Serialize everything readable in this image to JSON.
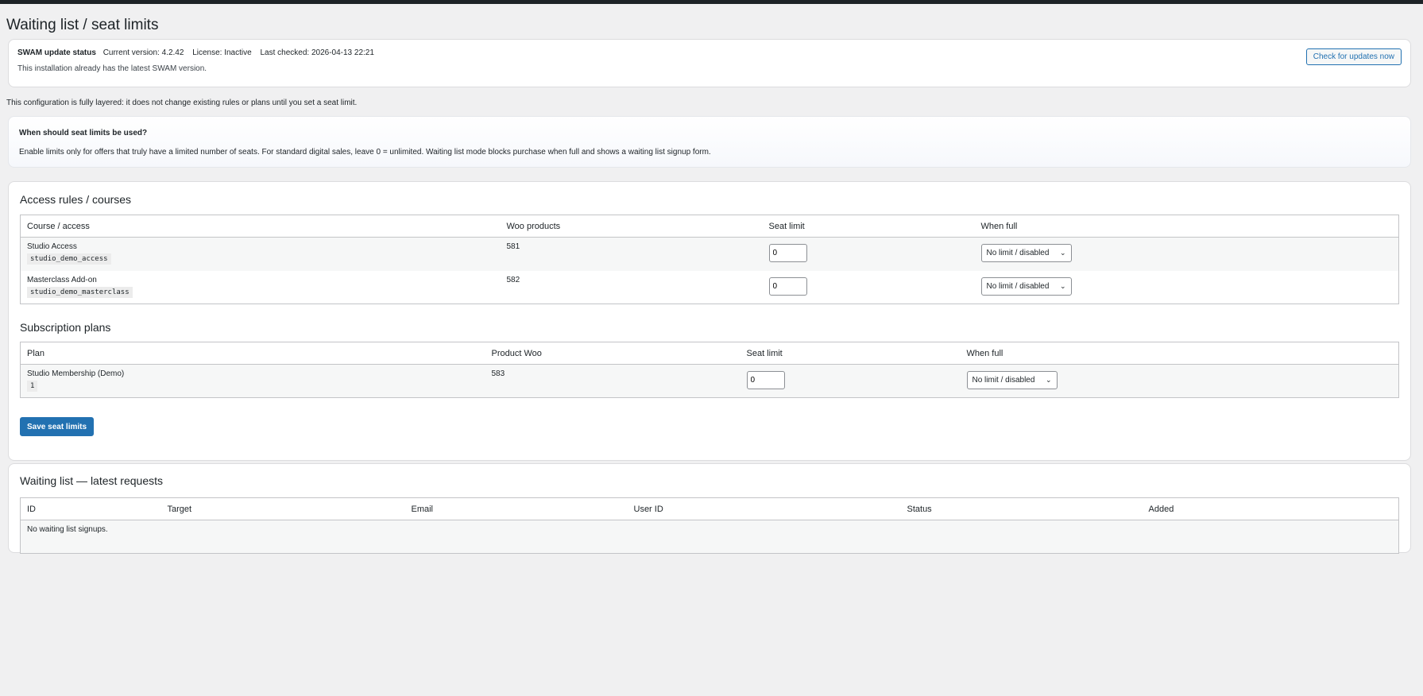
{
  "page": {
    "title": "Waiting list / seat limits"
  },
  "update": {
    "label": "SWAM update status",
    "current_version": "Current version: 4.2.42",
    "license": "License: Inactive",
    "last_checked": "Last checked: 2026-04-13 22:21",
    "message": "This installation already has the latest SWAM version.",
    "button": "Check for updates now"
  },
  "note": "This configuration is fully layered: it does not change existing rules or plans until you set a seat limit.",
  "info": {
    "title": "When should seat limits be used?",
    "text": "Enable limits only for offers that truly have a limited number of seats. For standard digital sales, leave 0 = unlimited. Waiting list mode blocks purchase when full and shows a waiting list signup form."
  },
  "access": {
    "heading": "Access rules / courses",
    "columns": [
      "Course / access",
      "Woo products",
      "Seat limit",
      "When full"
    ],
    "rows": [
      {
        "name": "Studio Access",
        "slug": "studio_demo_access",
        "products": "581",
        "limit": "0",
        "when_full": "No limit / disabled"
      },
      {
        "name": "Masterclass Add-on",
        "slug": "studio_demo_masterclass",
        "products": "582",
        "limit": "0",
        "when_full": "No limit / disabled"
      }
    ]
  },
  "plans": {
    "heading": "Subscription plans",
    "columns": [
      "Plan",
      "Product Woo",
      "Seat limit",
      "When full"
    ],
    "rows": [
      {
        "name": "Studio Membership (Demo)",
        "slug": "1",
        "products": "583",
        "limit": "0",
        "when_full": "No limit / disabled"
      }
    ]
  },
  "save_button": "Save seat limits",
  "waiting": {
    "heading": "Waiting list — latest requests",
    "columns": [
      "ID",
      "Target",
      "Email",
      "User ID",
      "Status",
      "Added"
    ],
    "empty": "No waiting list signups."
  }
}
